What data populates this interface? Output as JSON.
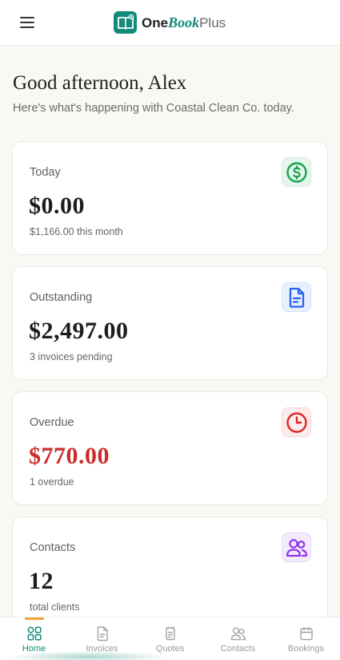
{
  "header": {
    "logo": {
      "one": "One",
      "book": "Book",
      "plus": "Plus"
    }
  },
  "greeting": {
    "title": "Good afternoon, Alex",
    "subtitle": "Here's what's happening with Coastal Clean Co. today."
  },
  "cards": [
    {
      "label": "Today",
      "value": "$0.00",
      "note": "$1,166.00 this month",
      "icon": "dollar-circle-icon",
      "color": "#16a34a"
    },
    {
      "label": "Outstanding",
      "value": "$2,497.00",
      "note": "3 invoices pending",
      "icon": "document-icon",
      "color": "#2563eb"
    },
    {
      "label": "Overdue",
      "value": "$770.00",
      "note": "1 overdue",
      "icon": "clock-icon",
      "color": "#dc2626"
    },
    {
      "label": "Contacts",
      "value": "12",
      "note": "total clients",
      "icon": "users-icon",
      "color": "#9333ea"
    }
  ],
  "nav": [
    {
      "label": "Home",
      "icon": "grid-icon",
      "active": true
    },
    {
      "label": "Invoices",
      "icon": "invoice-icon",
      "active": false
    },
    {
      "label": "Quotes",
      "icon": "quotes-icon",
      "active": false
    },
    {
      "label": "Contacts",
      "icon": "contacts-icon",
      "active": false
    },
    {
      "label": "Bookings",
      "icon": "calendar-icon",
      "active": false
    }
  ],
  "colors": {
    "brand": "#12897b",
    "accent": "#f0a23b",
    "overdue": "#cc2b2b"
  }
}
